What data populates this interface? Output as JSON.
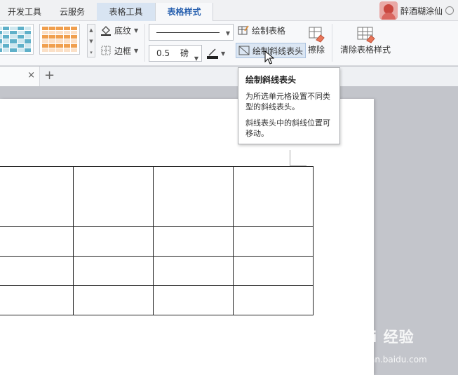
{
  "tabs": [
    {
      "label": "开发工具"
    },
    {
      "label": "云服务"
    },
    {
      "label": "表格工具"
    },
    {
      "label": "表格样式"
    }
  ],
  "user": {
    "name": "醉酒糊涂仙"
  },
  "ribbon": {
    "shading_label": "底纹",
    "border_label": "边框",
    "line_width_value": "0.5",
    "line_width_unit": "磅",
    "draw_table_label": "绘制表格",
    "draw_diagonal_label": "绘制斜线表头",
    "erase_label": "擦除",
    "clear_style_label": "清除表格样式"
  },
  "doc_tabs": {
    "close_glyph": "×",
    "add_glyph": "+"
  },
  "tooltip": {
    "title": "绘制斜线表头",
    "line1": "为所选单元格设置不同类型的斜线表头。",
    "line2": "斜线表头中的斜线位置可移动。"
  },
  "watermark": {
    "main": "Bai 经验",
    "sub": "jingyan.baidu.com"
  },
  "colors": {
    "active_tab": "#2a62b0",
    "contextual_tab": "#d8e4f2",
    "ribbon_bg": "#f7f8fa",
    "canvas_bg": "#c3c5cb"
  }
}
